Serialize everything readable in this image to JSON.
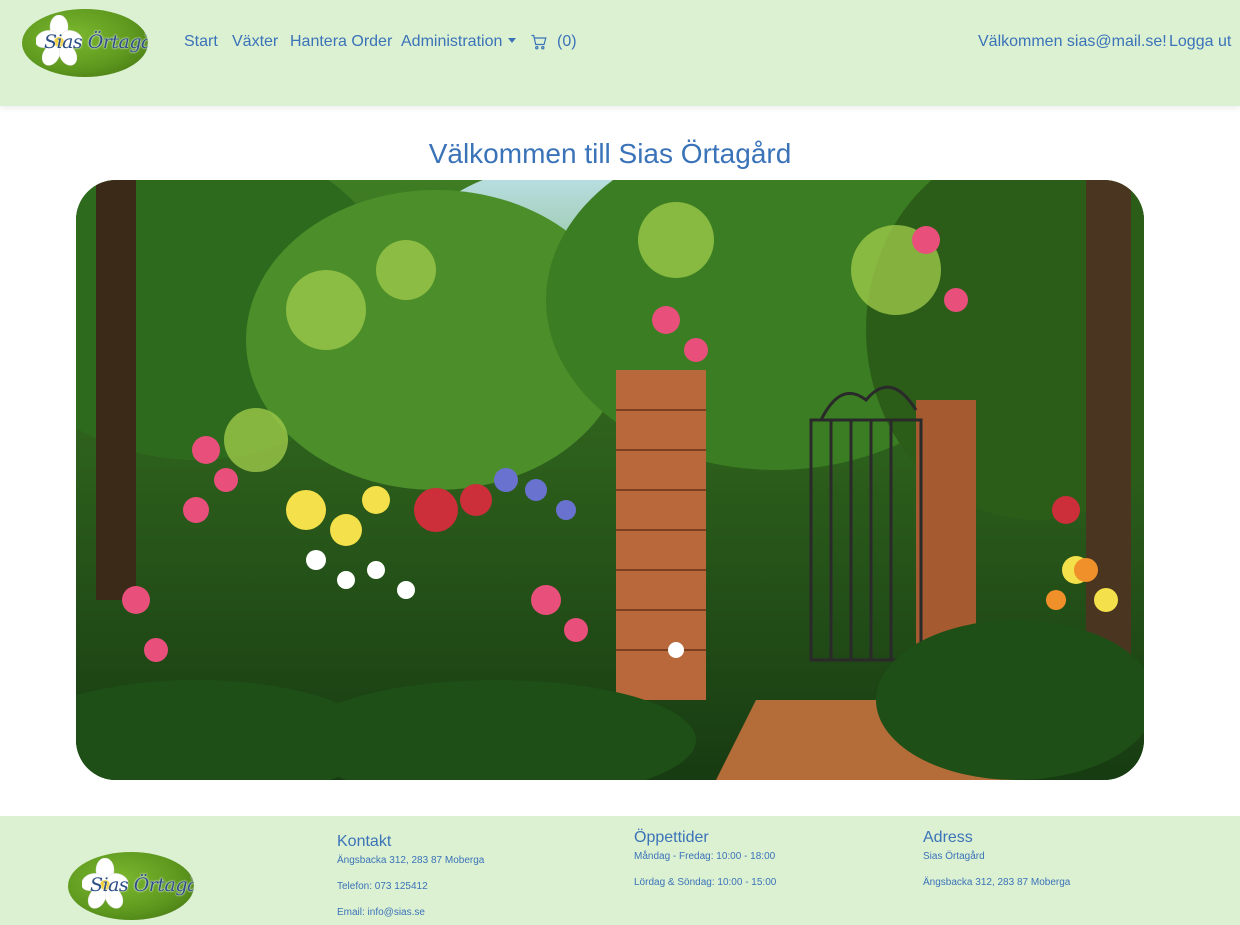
{
  "header": {
    "logo_text": "Sias Örtagård",
    "nav": {
      "start": "Start",
      "plants": "Växter",
      "orders": "Hantera Order",
      "admin": "Administration",
      "cart_count": "(0)"
    },
    "welcome": "Välkommen sias@mail.se!",
    "logout": "Logga ut"
  },
  "main": {
    "title": "Välkommen till Sias Örtagård",
    "hero_icon": "garden-painting"
  },
  "footer": {
    "logo_text": "Sias Örtagård",
    "contact": {
      "heading": "Kontakt",
      "address": "Ängsbacka 312, 283 87 Moberga",
      "phone": "Telefon: 073 125412",
      "email": "Email: info@sias.se"
    },
    "hours": {
      "heading": "Öppettider",
      "weekdays": "Måndag - Fredag: 10:00 - 18:00",
      "weekend": "Lördag & Söndag: 10:00 - 15:00"
    },
    "address": {
      "heading": "Adress",
      "name": "Sias Örtagård",
      "street": "Ängsbacka 312, 283 87 Moberga"
    }
  },
  "colors": {
    "header_bg": "#dcf0d2",
    "link": "#3a73b8",
    "logo_green": "#5f9a1f"
  }
}
